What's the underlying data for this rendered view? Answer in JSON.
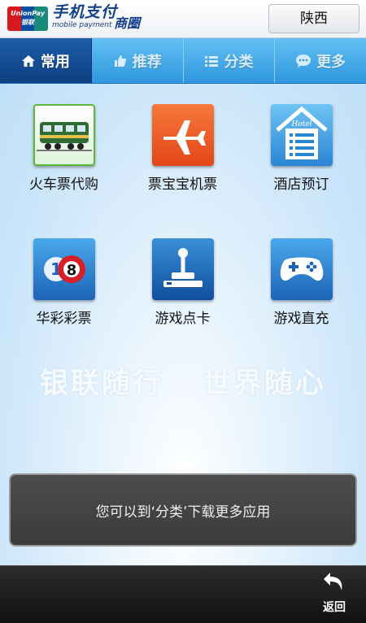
{
  "header": {
    "logo_text_top": "UnionPay",
    "logo_text_bottom": "银联",
    "brand_title": "手机支付",
    "brand_subtitle": "mobile payment",
    "brand_suffix": "商圈",
    "region": "陕西"
  },
  "tabs": [
    {
      "label": "常用",
      "icon": "home-icon",
      "active": true
    },
    {
      "label": "推荐",
      "icon": "thumbs-up-icon",
      "active": false
    },
    {
      "label": "分类",
      "icon": "list-icon",
      "active": false
    },
    {
      "label": "更多",
      "icon": "chat-bubble-icon",
      "active": false
    }
  ],
  "apps": [
    {
      "label": "火车票代购",
      "icon": "train-icon"
    },
    {
      "label": "票宝宝机票",
      "icon": "airplane-icon"
    },
    {
      "label": "酒店预订",
      "icon": "hotel-icon"
    },
    {
      "label": "华彩彩票",
      "icon": "lottery-balls-icon"
    },
    {
      "label": "游戏点卡",
      "icon": "joystick-icon"
    },
    {
      "label": "游戏直充",
      "icon": "gamepad-icon"
    }
  ],
  "icon_text": {
    "hotel_sign": "Hotel",
    "ball_1": "1",
    "ball_8": "8"
  },
  "watermark": {
    "left": "银联随行",
    "right": "世界随心"
  },
  "toast": "您可以到‘分类’下载更多应用",
  "bottom": {
    "back_label": "返回"
  },
  "colors": {
    "tab_active": "#0d3f82",
    "tab_bar": "#2e97de",
    "toast_bg": "#3b3b3b"
  }
}
